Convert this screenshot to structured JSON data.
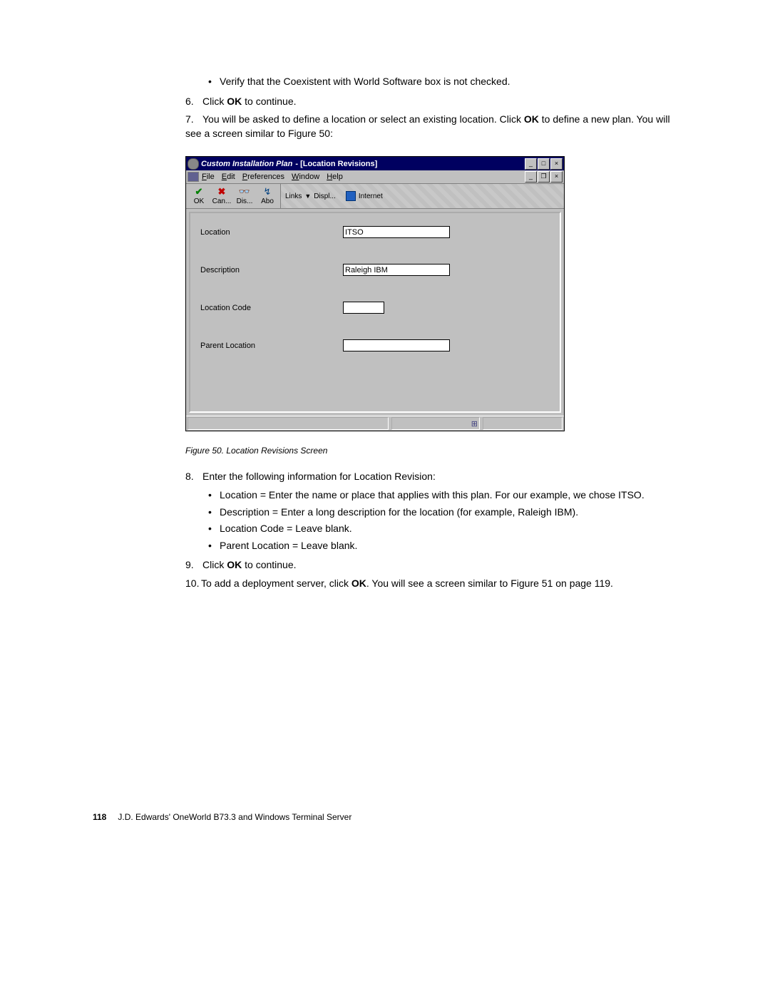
{
  "doc": {
    "bullet_top": "Verify that the Coexistent with World Software box is not checked.",
    "step6_num": "6.",
    "step6_text_a": "Click ",
    "step6_text_ok": "OK",
    "step6_text_b": " to continue.",
    "step7_num": "7.",
    "step7_text_a": "You will be asked to define a location or select an existing location. Click ",
    "step7_text_ok": "OK",
    "step7_text_b": " to define a new plan. You will see a screen similar to Figure 50:",
    "caption": "Figure 50.  Location Revisions Screen",
    "step8_num": "8.",
    "step8_text": "Enter the following information for Location Revision:",
    "step8_bullets": [
      "Location = Enter the name or place that applies with this plan. For our example, we chose ITSO.",
      "Description = Enter a long description for the location (for example, Raleigh IBM).",
      "Location Code = Leave blank.",
      "Parent Location = Leave blank."
    ],
    "step9_num": "9.",
    "step9_text_a": "Click ",
    "step9_text_ok": "OK",
    "step9_text_b": " to continue.",
    "step10_num": "10.",
    "step10_text_a": "To add a deployment server, click ",
    "step10_text_ok": "OK",
    "step10_text_b": ". You will see a screen similar to Figure 51 on page 119."
  },
  "window": {
    "title_italic": "Custom Installation Plan ",
    "title_bold": " - [Location Revisions]",
    "menus": {
      "file": "File",
      "edit": "Edit",
      "prefs": "Preferences",
      "window": "Window",
      "help": "Help"
    },
    "toolbar": {
      "ok": "OK",
      "can": "Can...",
      "dis": "Dis...",
      "abo": "Abo",
      "links": "Links",
      "displ": "Displ...",
      "internet": "Internet"
    },
    "form": {
      "location_label": "Location",
      "location_value": "ITSO",
      "description_label": "Description",
      "description_value": "Raleigh IBM",
      "locationcode_label": "Location Code",
      "locationcode_value": "",
      "parent_label": "Parent Location",
      "parent_value": ""
    }
  },
  "footer": {
    "page": "118",
    "text": "J.D. Edwards' OneWorld B73.3 and Windows Terminal Server"
  }
}
